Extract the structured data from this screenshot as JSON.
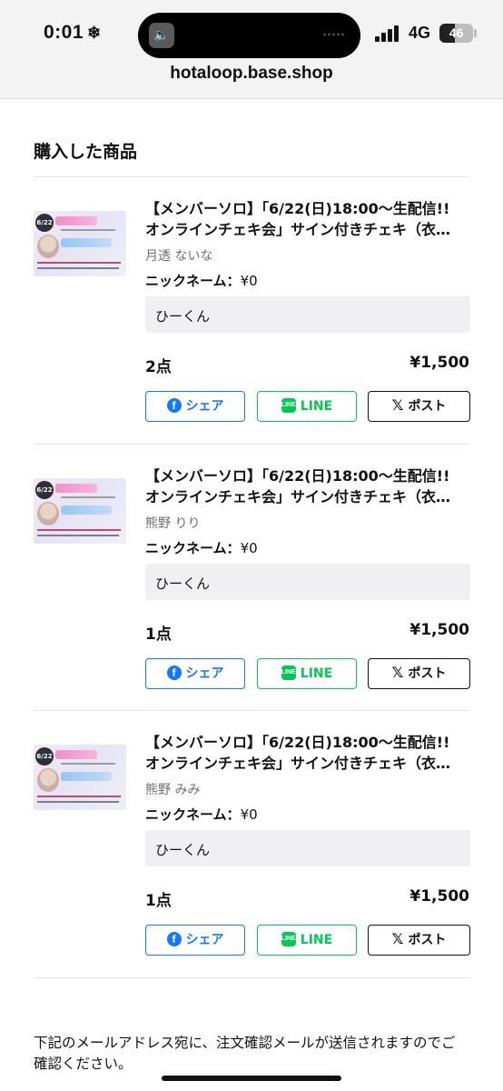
{
  "status_bar": {
    "time": "0:01",
    "network": "4G",
    "battery": "46"
  },
  "browser": {
    "url": "hotaloop.base.shop"
  },
  "section_title": "購入した商品",
  "share_buttons": {
    "facebook": "シェア",
    "line": "LINE",
    "x": "ポスト"
  },
  "nickname_label": "ニックネーム：",
  "items": [
    {
      "title_line1": "【メンバーソロ】「6/22(日)18:00〜生配信!!",
      "title_line2": "オンラインチェキ会」サイン付きチェキ（衣…",
      "member": "月透 ないな",
      "nickname_price": "¥0",
      "nickname_value": "ひーくん",
      "quantity": "2点",
      "price": "¥1,500"
    },
    {
      "title_line1": "【メンバーソロ】「6/22(日)18:00〜生配信!!",
      "title_line2": "オンラインチェキ会」サイン付きチェキ（衣…",
      "member": "熊野 りり",
      "nickname_price": "¥0",
      "nickname_value": "ひーくん",
      "quantity": "1点",
      "price": "¥1,500"
    },
    {
      "title_line1": "【メンバーソロ】「6/22(日)18:00〜生配信!!",
      "title_line2": "オンラインチェキ会」サイン付きチェキ（衣…",
      "member": "熊野 みみ",
      "nickname_price": "¥0",
      "nickname_value": "ひーくん",
      "quantity": "1点",
      "price": "¥1,500"
    }
  ],
  "footer_note": "下記のメールアドレス宛に、注文確認メールが送信されますのでご確認ください。"
}
